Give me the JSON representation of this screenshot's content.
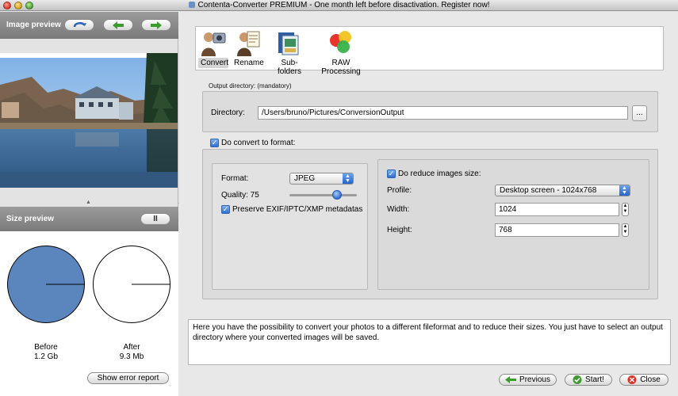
{
  "window": {
    "title": "Contenta-Converter PREMIUM - One month left before disactivation. Register now!"
  },
  "left": {
    "image_preview_label": "Image preview",
    "size_preview_label": "Size preview",
    "pause_symbol": "II",
    "before_label": "Before",
    "before_value": "1.2 Gb",
    "after_label": "After",
    "after_value": "9.3 Mb",
    "show_error_report": "Show error report",
    "before_fill_color": "#5b86bd"
  },
  "toolbar": {
    "items": [
      {
        "label": "Convert",
        "icon": "convert-icon",
        "selected": true
      },
      {
        "label": "Rename",
        "icon": "rename-icon",
        "selected": false
      },
      {
        "label": "Sub-folders",
        "icon": "subfolders-icon",
        "selected": false
      },
      {
        "label": "RAW Processing",
        "icon": "raw-processing-icon",
        "selected": false
      }
    ]
  },
  "output": {
    "section_label": "Output directory: (mandatory)",
    "directory_label": "Directory:",
    "directory_value": "/Users/bruno/Pictures/ConversionOutput",
    "browse_label": "..."
  },
  "format": {
    "do_convert_label": "Do convert to format:",
    "do_convert_checked": true,
    "format_label": "Format:",
    "format_value": "JPEG",
    "quality_label": "Quality: 75",
    "quality_value": 75,
    "preserve_label": "Preserve EXIF/IPTC/XMP metadatas",
    "preserve_checked": true
  },
  "resize": {
    "do_reduce_label": "Do reduce images size:",
    "do_reduce_checked": true,
    "profile_label": "Profile:",
    "profile_value": "Desktop screen - 1024x768",
    "width_label": "Width:",
    "width_value": "1024",
    "height_label": "Height:",
    "height_value": "768"
  },
  "description": "Here you have the possibility to convert your photos to a different fileformat and to reduce their sizes. You just have to select an output directory where your converted images will be saved.",
  "footer": {
    "previous_label": "Previous",
    "start_label": "Start!",
    "close_label": "Close"
  }
}
